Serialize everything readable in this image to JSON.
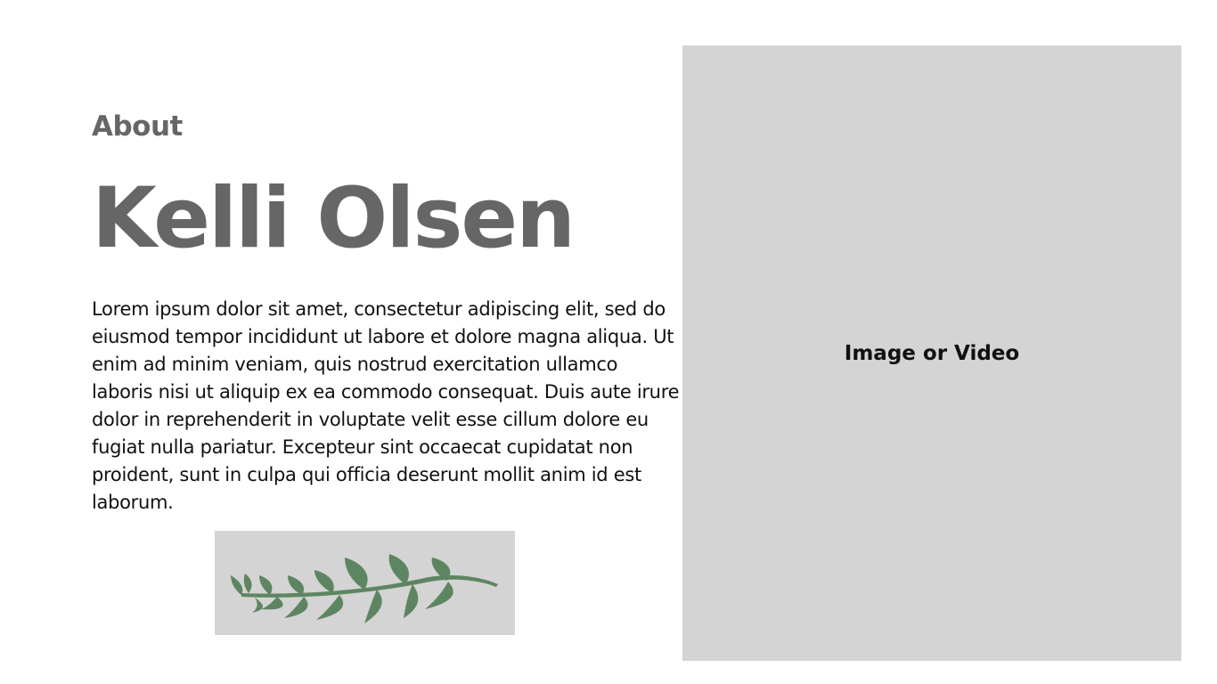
{
  "about": {
    "label": "About",
    "name": "Kelli Olsen",
    "bio": "Lorem ipsum dolor sit amet, consectetur adipiscing elit, sed do eiusmod tempor incididunt ut labore et dolore magna aliqua. Ut enim ad minim veniam, quis nostrud exercitation ullamco laboris nisi ut aliquip ex ea commodo consequat. Duis aute irure dolor in reprehenderit in voluptate velit esse cillum dolore eu fugiat nulla pariatur. Excepteur sint occaecat cupidatat non proident, sunt in culpa qui officia deserunt mollit anim id est laborum."
  },
  "media": {
    "placeholder_label": "Image or Video"
  },
  "decoration": {
    "icon": "leaf-branch-icon"
  },
  "colors": {
    "heading": "#666666",
    "body_text": "#111111",
    "placeholder_bg": "#d4d4d4",
    "leaf": "#5e8561"
  }
}
